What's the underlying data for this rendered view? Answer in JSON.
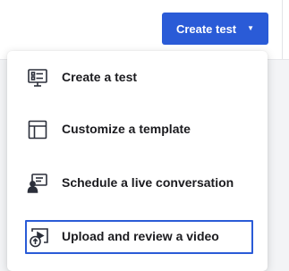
{
  "header": {
    "create_button_label": "Create test",
    "create_button_caret": "▼"
  },
  "menu": {
    "items": [
      {
        "label": "Create a test",
        "icon": "test-monitor-icon"
      },
      {
        "label": "Customize a template",
        "icon": "template-layout-icon"
      },
      {
        "label": "Schedule a live conversation",
        "icon": "live-conversation-icon"
      },
      {
        "label": "Upload and review a video",
        "icon": "upload-video-icon",
        "focused": true
      }
    ]
  },
  "colors": {
    "accent": "#2a5bd7",
    "text": "#1b1b1f",
    "icon_stroke": "#2b2f3a"
  }
}
